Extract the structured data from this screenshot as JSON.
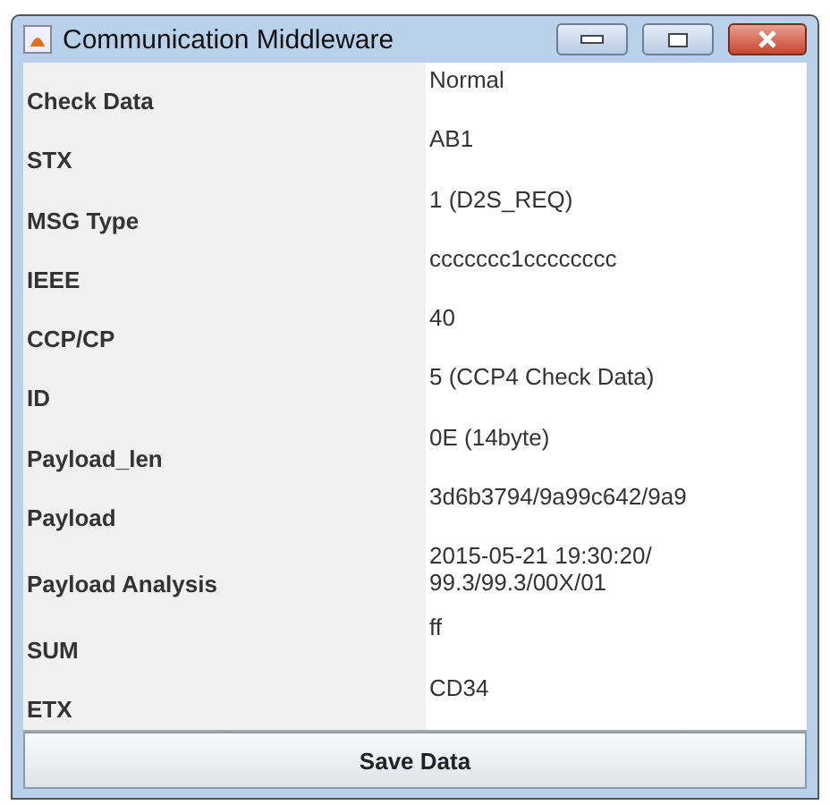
{
  "window": {
    "title": "Communication Middleware"
  },
  "fields": [
    {
      "label": "Check Data",
      "value": "Normal"
    },
    {
      "label": "STX",
      "value": "AB1"
    },
    {
      "label": "MSG Type",
      "value": "1 (D2S_REQ)"
    },
    {
      "label": "IEEE",
      "value": "ccccccc1cccccccc"
    },
    {
      "label": "CCP/CP",
      "value": "40"
    },
    {
      "label": "ID",
      "value": "5 (CCP4 Check Data)"
    },
    {
      "label": "Payload_len",
      "value": "0E (14byte)"
    },
    {
      "label": "Payload",
      "value": "3d6b3794/9a99c642/9a9"
    },
    {
      "label": "Payload Analysis",
      "value": "2015-05-21 19:30:20/\n99.3/99.3/00X/01"
    },
    {
      "label": "SUM",
      "value": "ff"
    },
    {
      "label": "ETX",
      "value": "CD34"
    }
  ],
  "buttons": [
    "Save Data"
  ]
}
